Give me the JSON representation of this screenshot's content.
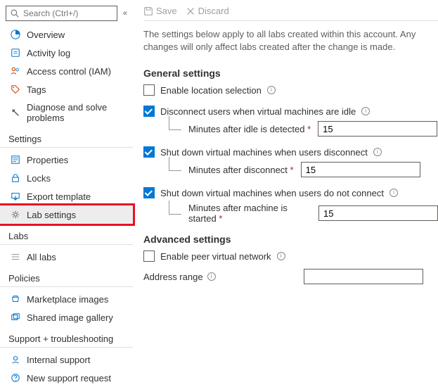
{
  "search": {
    "placeholder": "Search (Ctrl+/)"
  },
  "nav": {
    "overview": "Overview",
    "activity_log": "Activity log",
    "access_control": "Access control (IAM)",
    "tags": "Tags",
    "diagnose": "Diagnose and solve problems",
    "section_settings": "Settings",
    "properties": "Properties",
    "locks": "Locks",
    "export_template": "Export template",
    "lab_settings": "Lab settings",
    "section_labs": "Labs",
    "all_labs": "All labs",
    "section_policies": "Policies",
    "marketplace_images": "Marketplace images",
    "shared_image_gallery": "Shared image gallery",
    "section_support": "Support + troubleshooting",
    "internal_support": "Internal support",
    "new_support_request": "New support request"
  },
  "toolbar": {
    "save": "Save",
    "discard": "Discard"
  },
  "intro": "The settings below apply to all labs created within this account. Any changes will only affect labs created after the change is made.",
  "general": {
    "heading": "General settings",
    "enable_location": "Enable location selection",
    "disconnect_idle": "Disconnect users when virtual machines are idle",
    "idle_minutes_label": "Minutes after idle is detected",
    "idle_minutes_value": "15",
    "shutdown_disconnect": "Shut down virtual machines when users disconnect",
    "disconnect_minutes_label": "Minutes after disconnect",
    "disconnect_minutes_value": "15",
    "shutdown_noconnect": "Shut down virtual machines when users do not connect",
    "noconnect_minutes_label": "Minutes after machine is started",
    "noconnect_minutes_value": "15"
  },
  "advanced": {
    "heading": "Advanced settings",
    "enable_peer": "Enable peer virtual network",
    "address_range": "Address range",
    "address_range_value": ""
  }
}
